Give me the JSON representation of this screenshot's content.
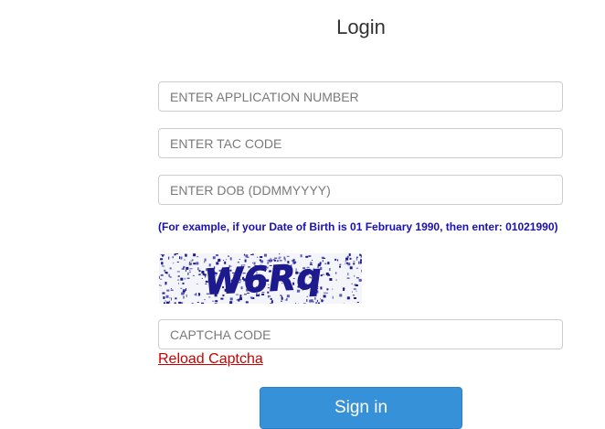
{
  "page": {
    "title": "Login"
  },
  "form": {
    "application_number": {
      "value": "",
      "placeholder": "ENTER APPLICATION NUMBER"
    },
    "tac_code": {
      "value": "",
      "placeholder": "ENTER TAC CODE"
    },
    "dob": {
      "value": "",
      "placeholder": "ENTER DOB (DDMMYYYY)"
    },
    "dob_hint": "(For example, if your Date of Birth is 01 February 1990, then enter: 01021990)",
    "captcha_image_text": "W6Rq",
    "captcha": {
      "value": "",
      "placeholder": "CAPTCHA CODE"
    },
    "reload_link": "Reload Captcha",
    "signin_button": "Sign in"
  },
  "colors": {
    "hint": "#1a11b0",
    "link": "#cc0000",
    "button": "#3791d9",
    "captcha_ink": "#1c1a8c"
  }
}
